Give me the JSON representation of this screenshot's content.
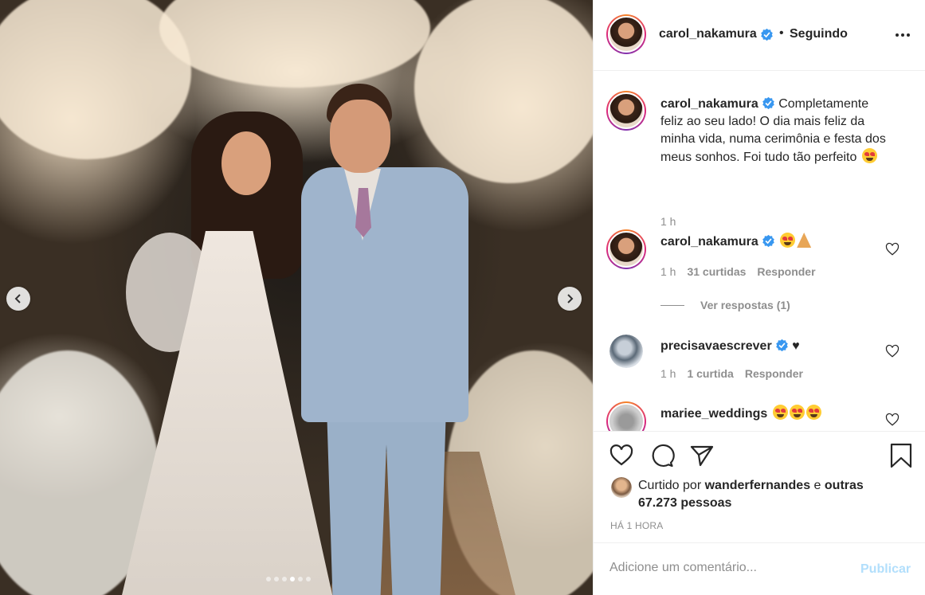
{
  "post": {
    "author": "carol_nakamura",
    "follow_separator": "•",
    "follow_status": "Seguindo",
    "carousel": {
      "total_slides": 6,
      "active_slide": 4
    }
  },
  "comments": [
    {
      "user": "carol_nakamura",
      "text": "Completamente feliz ao seu lado! O dia mais feliz da minha vida, numa cerimônia e festa dos meus sonhos. Foi tudo tão perfeito",
      "emoji": [
        "heart-eyes-emoji"
      ],
      "time": "1 h"
    },
    {
      "user": "carol_nakamura",
      "emoji": [
        "heart-eyes-emoji",
        "folded-hands-emoji"
      ],
      "time": "1 h",
      "likes": "31 curtidas",
      "reply": "Responder",
      "view_replies": "Ver respostas (1)"
    },
    {
      "user": "precisavaescrever",
      "text": "♥",
      "time": "1 h",
      "likes": "1 curtida",
      "reply": "Responder"
    },
    {
      "user": "mariee_weddings",
      "emoji": [
        "heart-eyes-emoji",
        "heart-eyes-emoji",
        "heart-eyes-emoji"
      ]
    }
  ],
  "likes": {
    "prefix": "Curtido por",
    "user": "wanderfernandes",
    "conjunction": "e",
    "others": "outras 67.273 pessoas"
  },
  "timestamp": "HÁ 1 HORA",
  "add_comment": {
    "placeholder": "Adicione um comentário...",
    "publish_label": "Publicar"
  },
  "colors": {
    "verified": "#3897f0",
    "publish_disabled": "#b2dffc",
    "muted_text": "#8e8e8e"
  }
}
